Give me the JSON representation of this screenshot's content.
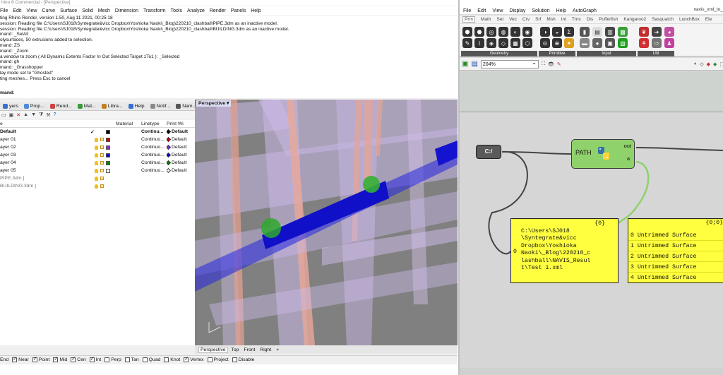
{
  "rhino": {
    "title": "hino 6 Commercial - [Perspective]",
    "menu": [
      "File",
      "Edit",
      "View",
      "Curve",
      "Surface",
      "Solid",
      "Mesh",
      "Dimension",
      "Transform",
      "Tools",
      "Analyze",
      "Render",
      "Panels",
      "Help"
    ],
    "history": [
      "ting Rhino Render, version 1.50, Aug 11 2021, 00:25:18",
      "session: Reading file C:\\Users\\SJ018\\Syntegrate&vicc Dropbox\\Yoshioka Naoki\\_Blog\\220210_clashball\\PIPE.3dm as an inactive model.",
      "session: Reading file C:\\Users\\SJ018\\Syntegrate&vicc Dropbox\\Yoshioka Naoki\\_Blog\\220210_clashball\\BUILDING.3dm as an inactive model.",
      "mand: _SelAll",
      "olysurfaces, 50 extrusions added to selection.",
      "mand: ZS",
      "mand: _Zoom",
      "a window to zoom ( All  Dynamic  Extents  Factor  In  Out  Selected  Target  1To1 ): _Selected",
      "mand: gh",
      "mand: _Grasshopper",
      "lay mode set to \"Ghosted\"",
      "ting meshes... Press Esc to cancel"
    ],
    "prompt": "mand:",
    "panel_tabs": [
      "yers",
      "Prop...",
      "Rend...",
      "Mat...",
      "Libra...",
      "Help",
      "Notif...",
      "Nam..."
    ],
    "layer_headers": {
      "name": "e",
      "material": "Material",
      "linetype": "Linetype",
      "print": "Print Wi"
    },
    "layers": [
      {
        "name": "Default",
        "current": "✓",
        "color": "#000000",
        "linetype": "Continu...",
        "print": "Default",
        "bold": true
      },
      {
        "name": "ayer 01",
        "current": "",
        "color": "#cc0000",
        "linetype": "Continuo...",
        "print": "Default",
        "bold": false
      },
      {
        "name": "ayer 02",
        "current": "",
        "color": "#8a2be2",
        "linetype": "Continuo...",
        "print": "Default",
        "bold": false
      },
      {
        "name": "ayer 03",
        "current": "",
        "color": "#0000cc",
        "linetype": "Continuo...",
        "print": "Default",
        "bold": false
      },
      {
        "name": "ayer 04",
        "current": "",
        "color": "#008800",
        "linetype": "Continuo...",
        "print": "Default",
        "bold": false
      },
      {
        "name": "ayer 05",
        "current": "",
        "color": "#ffffff",
        "linetype": "Continuo...",
        "print": "Default",
        "bold": false
      }
    ],
    "linked": [
      "PIPE.3dm ]",
      "BUILDING.3dm ]"
    ],
    "viewport_label": "Perspective",
    "viewport_tabs": [
      "Perspective",
      "Top",
      "Front",
      "Right"
    ],
    "osnaps": [
      {
        "label": "End",
        "on": true
      },
      {
        "label": "Near",
        "on": true
      },
      {
        "label": "Point",
        "on": true
      },
      {
        "label": "Mid",
        "on": true
      },
      {
        "label": "Cen",
        "on": true
      },
      {
        "label": "Int",
        "on": true
      },
      {
        "label": "Perp",
        "on": false
      },
      {
        "label": "Tan",
        "on": false
      },
      {
        "label": "Quad",
        "on": false
      },
      {
        "label": "Knot",
        "on": false
      },
      {
        "label": "Vertex",
        "on": true
      },
      {
        "label": "Project",
        "on": false
      },
      {
        "label": "Disable",
        "on": false
      }
    ]
  },
  "grasshopper": {
    "menu": [
      "File",
      "Edit",
      "View",
      "Display",
      "Solution",
      "Help",
      "AutoGraph"
    ],
    "filename": "navis_xml_to_",
    "tabs": [
      "Prm",
      "Math",
      "Set",
      "Vec",
      "Crv",
      "Srf",
      "Msh",
      "Int",
      "Trns",
      "Dis",
      "Pufferfish",
      "Kangaroo2",
      "Sasquatch",
      "LunchBox",
      "Ele"
    ],
    "ribbon_groups": [
      "Geometry",
      "Primitive",
      "Input",
      "Util"
    ],
    "zoom": "204%",
    "cpath_label": "C:/",
    "path_comp": {
      "label": "PATH",
      "out": "out",
      "in": "a"
    },
    "panel_a": {
      "header": "{0}",
      "index": "0",
      "text": "C:\\Users\\SJ018\n\\Syntegrate&vicc\nDropbox\\Yoshioka\nNaoki\\_Blog\\220210_c\nlashball\\NAVIS_Resul\nt\\Test 1.xml"
    },
    "panel_b": {
      "header": "{0;0}",
      "rows": [
        {
          "idx": "0",
          "value": "Untrimmed Surface"
        },
        {
          "idx": "1",
          "value": "Untrimmed Surface"
        },
        {
          "idx": "2",
          "value": "Untrimmed Surface"
        },
        {
          "idx": "3",
          "value": "Untrimmed Surface"
        },
        {
          "idx": "4",
          "value": "Untrimmed Surface"
        }
      ]
    }
  },
  "colors": {
    "pipe": "#1a1ad0",
    "clash_ball": "#2ea82e",
    "gh_component": "#8fd16a",
    "gh_panel": "#ffff40"
  }
}
